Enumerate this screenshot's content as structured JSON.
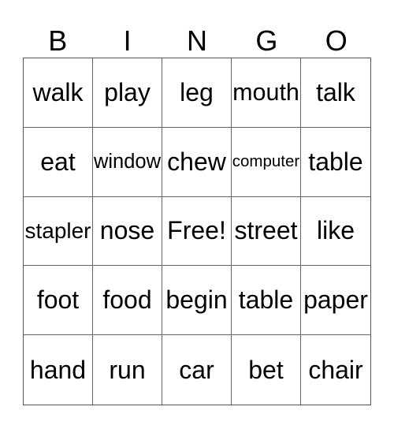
{
  "header": [
    "B",
    "I",
    "N",
    "G",
    "O"
  ],
  "cells": [
    "walk",
    "play",
    "leg",
    "mouth",
    "talk",
    "eat",
    "window",
    "chew",
    "computer",
    "table",
    "stapler",
    "nose",
    "Free!",
    "street",
    "like",
    "foot",
    "food",
    "begin",
    "table",
    "paper",
    "hand",
    "run",
    "car",
    "bet",
    "chair"
  ]
}
